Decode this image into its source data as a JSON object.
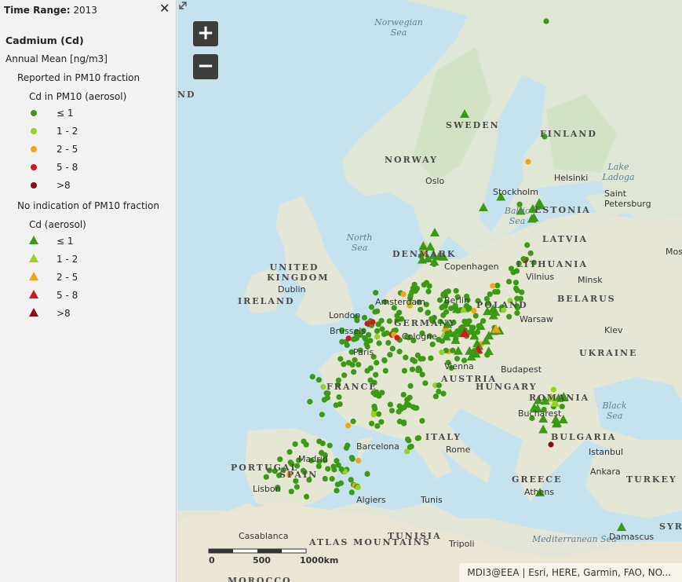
{
  "legend": {
    "header_label": "Time Range:",
    "header_value": "2013",
    "close_label": "✕",
    "title": "Cadmium (Cd)",
    "subtitle": "Annual Mean [ng/m3]",
    "group1": "Reported in PM10 fraction",
    "group1_sub": "Cd in PM10 (aerosol)",
    "group2": "No indication of PM10 fraction",
    "group2_sub": "Cd (aerosol)",
    "classes": [
      {
        "label": "≤ 1",
        "color": "#3a9a14"
      },
      {
        "label": "1 - 2",
        "color": "#96d320"
      },
      {
        "label": "2 - 5",
        "color": "#f0a416"
      },
      {
        "label": "5 - 8",
        "color": "#d8141c"
      },
      {
        "label": ">8",
        "color": "#8a0e0e"
      }
    ]
  },
  "map": {
    "zoom_in": "+",
    "zoom_out": "−",
    "labels": {
      "norwegian_sea": "Norwegian Sea",
      "north_sea": "North Sea",
      "baltic_sea": "Baltic Sea",
      "lake_ladoga": "Lake Ladoga",
      "black_sea": "Black Sea",
      "mediterranean_sea": "Mediterranean Sea",
      "sweden": "SWEDEN",
      "norway": "NORWAY",
      "finland": "FINLAND",
      "estonia": "ESTONIA",
      "latvia": "LATVIA",
      "lithuania": "LITHUANIA",
      "denmark": "DENMARK",
      "united_kingdom": "UNITED KINGDOM",
      "ireland": "IRELAND",
      "belarus": "BELARUS",
      "poland": "POLAND",
      "germany": "GERMANY",
      "ukraine": "UKRAINE",
      "france": "FRANCE",
      "austria": "AUSTRIA",
      "hungary": "HUNGARY",
      "romania": "ROMANIA",
      "italy": "ITALY",
      "bulgaria": "BULGARIA",
      "portugal": "PORTUGAL",
      "spain": "SPAIN",
      "greece": "GREECE",
      "turkey": "TURKEY",
      "tunisia": "TUNISIA",
      "morocco": "MOROCCO",
      "syria": "SYRI",
      "atlas": "ATLAS MOUNTAINS",
      "nd": "ND",
      "oslo": "Oslo",
      "helsinki": "Helsinki",
      "stockholm": "Stockholm",
      "saint_petersburg": "Saint Petersburg",
      "copenhagen": "Copenhagen",
      "mos": "Mos",
      "vilnius": "Vilnius",
      "minsk": "Minsk",
      "dublin": "Dublin",
      "amsterdam": "Amsterdam",
      "berlin": "Berlin",
      "warsaw": "Warsaw",
      "london": "London",
      "brussels": "Brussels",
      "cologne": "Cologne",
      "kiev": "Kiev",
      "paris": "Paris",
      "vienna": "Vienna",
      "budapest": "Budapest",
      "bucharest": "Bucharest",
      "madrid": "Madrid",
      "barcelona": "Barcelona",
      "rome": "Rome",
      "istanbul": "Istanbul",
      "ankara": "Ankara",
      "lisbon": "Lisbon",
      "algiers": "Algiers",
      "tunis": "Tunis",
      "athens": "Athens",
      "casablanca": "Casablanca",
      "tripoli": "Tripoli",
      "damascus": "Damascus"
    },
    "scale": {
      "t0": "0",
      "t1": "500",
      "t2": "1000km"
    },
    "attribution": "MDI3@EEA  |  Esri, HERE, Garmin, FAO, NO..."
  }
}
